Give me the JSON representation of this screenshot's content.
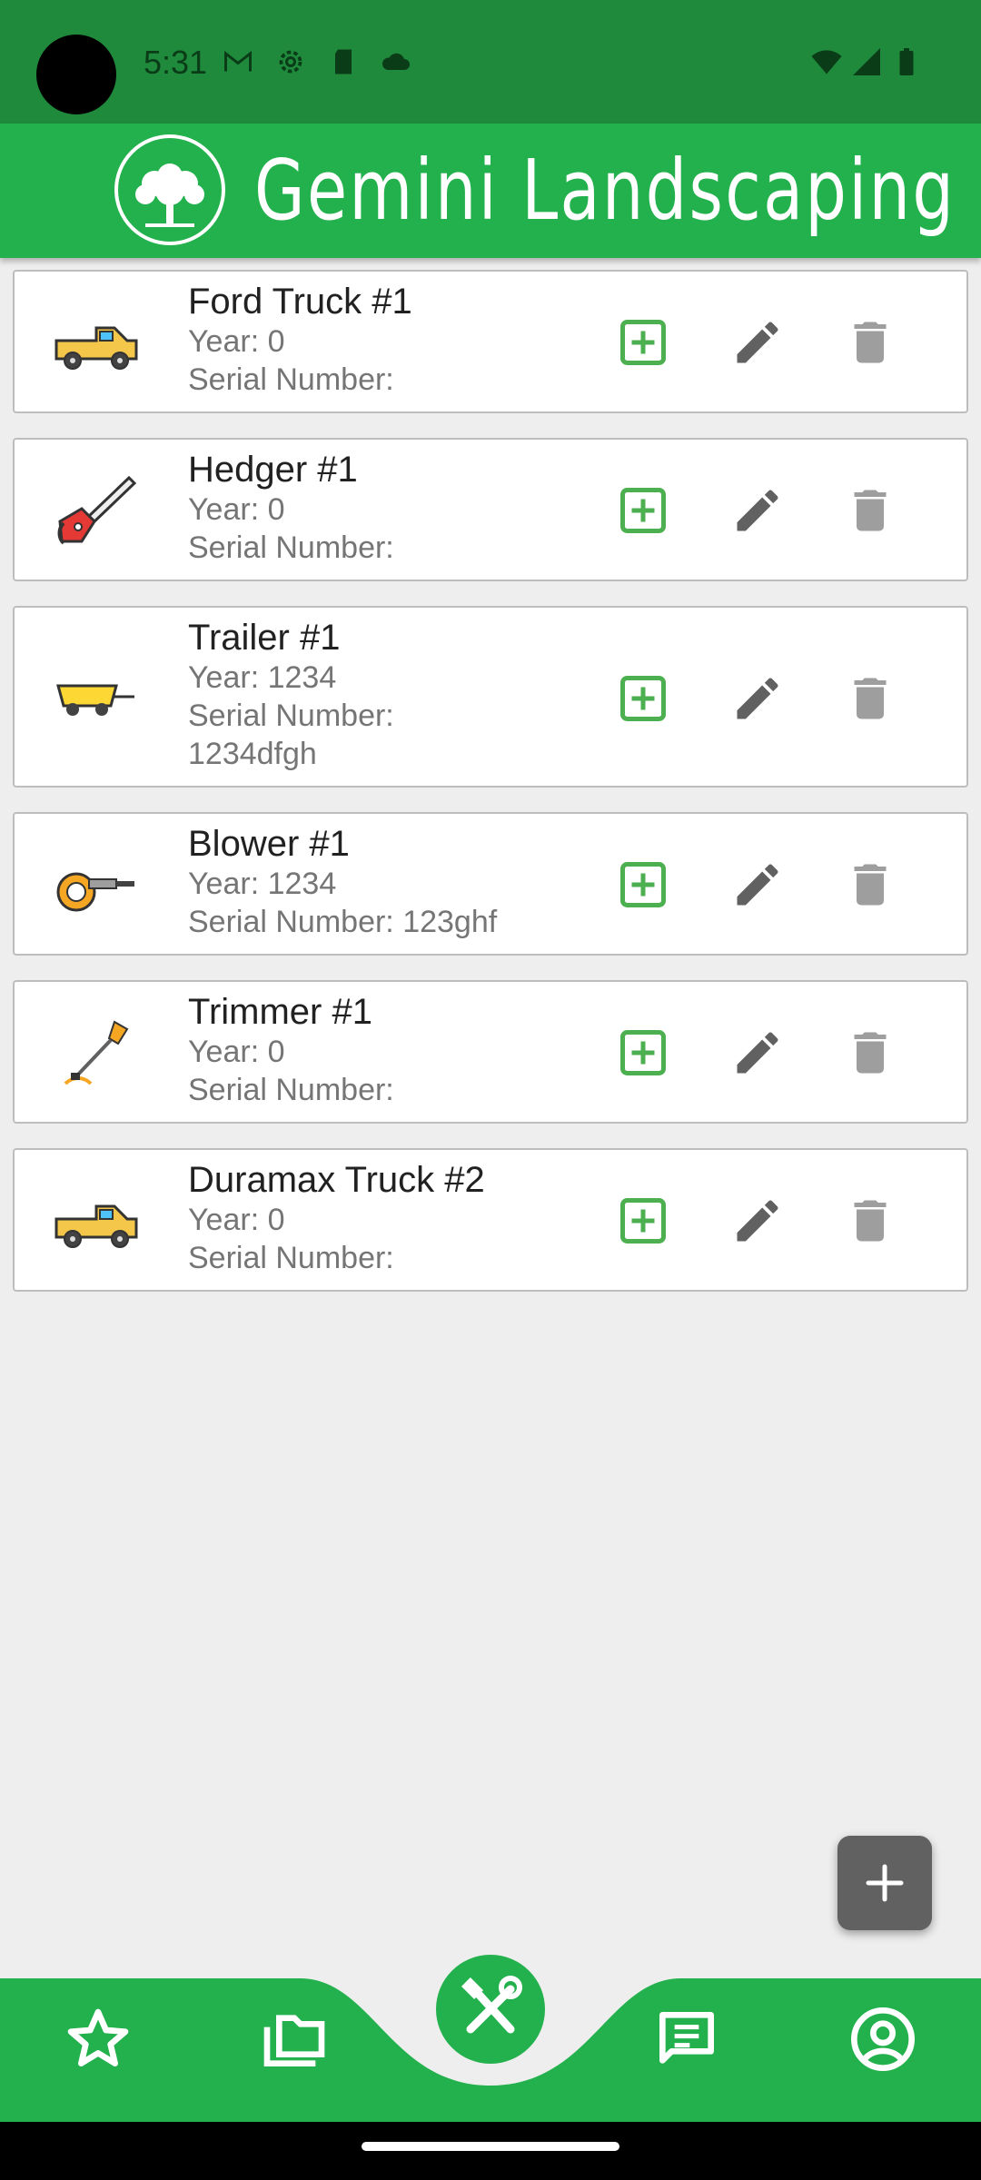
{
  "status_bar": {
    "time": "5:31",
    "left_icons": [
      "gmail-icon",
      "settings-gear-icon",
      "sd-card-icon",
      "cloud-icon"
    ],
    "right_icons": [
      "wifi-icon",
      "cellular-signal-icon",
      "battery-icon"
    ]
  },
  "header": {
    "title": "Gemini Landscaping",
    "logo_icon": "tree-logo-icon"
  },
  "equipment": [
    {
      "name": "Ford Truck #1",
      "year": "Year: 0",
      "serial": "Serial Number:",
      "icon": "pickup-truck-icon"
    },
    {
      "name": "Hedger #1",
      "year": "Year: 0",
      "serial": "Serial Number:",
      "icon": "chainsaw-hedger-icon"
    },
    {
      "name": "Trailer #1",
      "year": "Year: 1234",
      "serial": "Serial Number:",
      "serial_extra": "1234dfgh",
      "icon": "trailer-icon"
    },
    {
      "name": "Blower #1",
      "year": "Year: 1234",
      "serial": "Serial Number: 123ghf",
      "icon": "leaf-blower-icon"
    },
    {
      "name": "Trimmer #1",
      "year": "Year: 0",
      "serial": "Serial Number:",
      "icon": "string-trimmer-icon"
    },
    {
      "name": "Duramax Truck #2",
      "year": "Year: 0",
      "serial": "Serial Number:",
      "icon": "pickup-truck-icon"
    }
  ],
  "actions": {
    "add_icon": "add-box-icon",
    "edit_icon": "pencil-edit-icon",
    "delete_icon": "trash-delete-icon"
  },
  "fab": {
    "icon": "plus-icon"
  },
  "bottom_nav": [
    {
      "icon": "star-outline-icon"
    },
    {
      "icon": "folder-copy-icon"
    },
    {
      "icon": "tools-hammer-wrench-icon",
      "active": true
    },
    {
      "icon": "chat-message-icon"
    },
    {
      "icon": "account-circle-icon"
    }
  ],
  "colors": {
    "status_bar": "#1f8a3b",
    "primary_green": "#22b14c",
    "add_green": "#4caf50",
    "action_gray": "#616161",
    "delete_gray": "#9e9e9e",
    "background": "#eeeeee"
  }
}
